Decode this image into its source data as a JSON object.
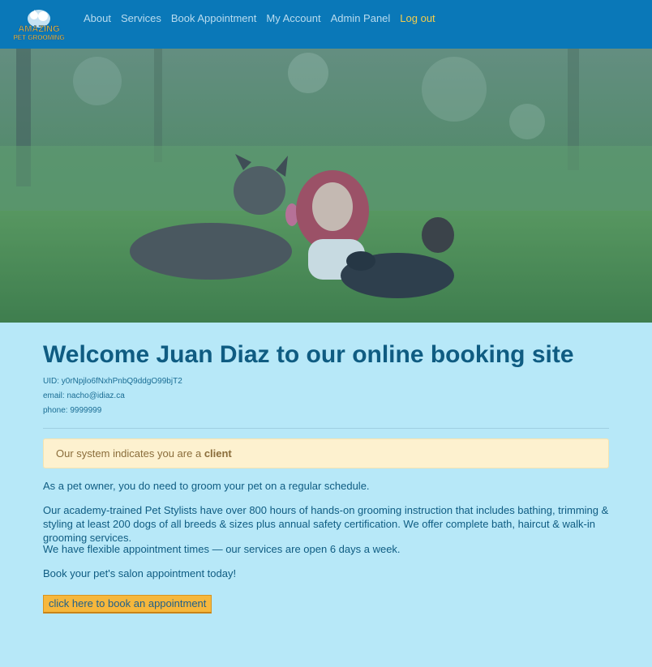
{
  "brand": {
    "logo_line1": "AMAZING",
    "logo_line2": "PET GROOMING"
  },
  "nav": {
    "links": [
      "About",
      "Services",
      "Book Appointment",
      "My Account",
      "Admin Panel"
    ],
    "logout": "Log out"
  },
  "welcome": {
    "prefix": "Welcome ",
    "name": "Juan Diaz",
    "suffix": " to our online booking site"
  },
  "user": {
    "uid": "UID: y0rNpjlo6fNxhPnbQ9ddgO99bjT2",
    "email": "email: nacho@idiaz.ca",
    "phone": "phone: 9999999"
  },
  "alert": {
    "prefix": "Our system indicates you are a ",
    "role": "client"
  },
  "paragraphs": [
    "As a pet owner, you do need to groom your pet on a regular schedule.",
    "Our academy-trained Pet Stylists have over 800 hours of hands-on grooming instruction that includes bathing, trimming & styling at least 200 dogs of all breeds & sizes plus annual safety certification. We offer complete bath, haircut & walk-in grooming services.",
    "We have flexible appointment times — our services are open 6 days a week.",
    "Book your pet's salon appointment today!"
  ],
  "cta": {
    "label": "click here to book an appointment"
  },
  "colors": {
    "navbar": "#0a78b8",
    "page_background": "#b7e8f8",
    "accent_link": "#f3cd4c",
    "button": "#f6b73c",
    "alert_background": "#fdf1cf"
  }
}
